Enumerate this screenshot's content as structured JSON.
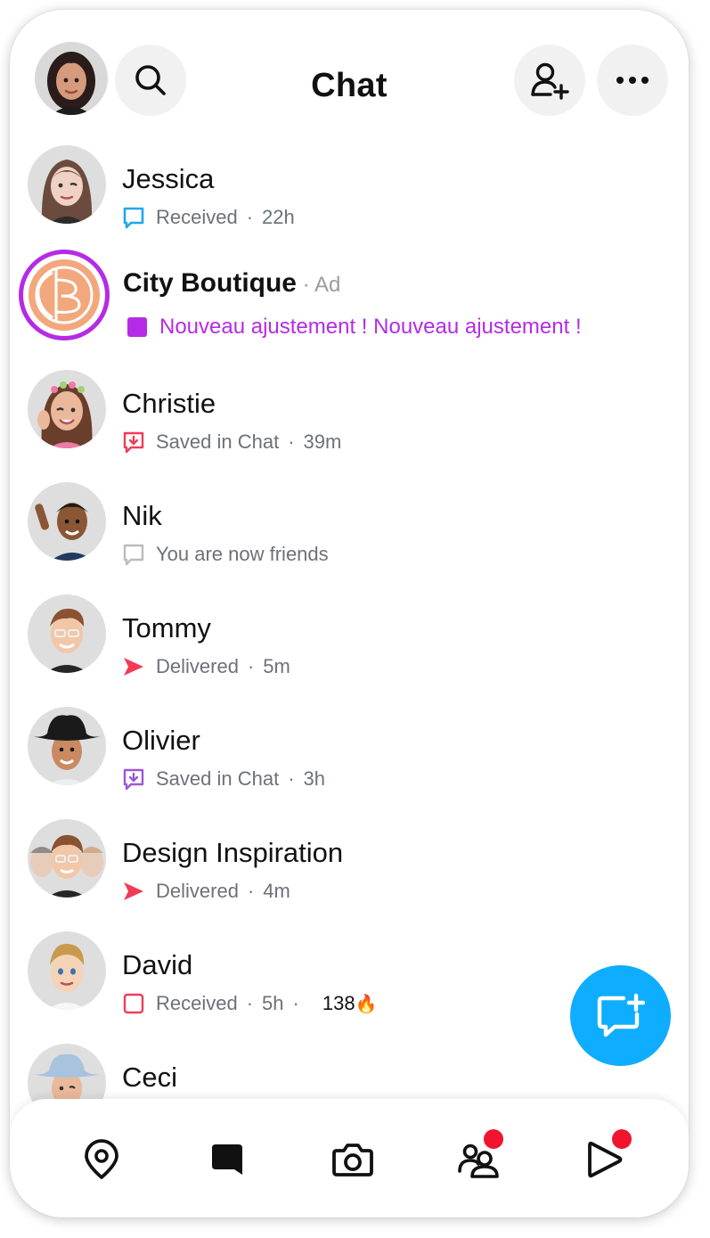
{
  "header": {
    "title": "Chat",
    "profile_icon": "bitmoji-avatar",
    "search_icon": "search-icon",
    "add_friend_icon": "add-friend-icon",
    "more_icon": "more-icon"
  },
  "chats": [
    {
      "name": "Jessica",
      "status": "Received",
      "time": "22h",
      "icon": "chat-received-outline",
      "color": "#1fa7f0"
    },
    {
      "name": "City Boutique",
      "ad_label": "Ad",
      "message": "Nouveau ajustement ! Nouveau ajustement !",
      "icon": "ad-square-filled",
      "color": "#b52be5"
    },
    {
      "name": "Christie",
      "status": "Saved in Chat",
      "time": "39m",
      "icon": "saved-in-chat",
      "color": "#f23c57"
    },
    {
      "name": "Nik",
      "status": "You are now friends",
      "icon": "chat-empty-outline",
      "color": "#b9bbbf"
    },
    {
      "name": "Tommy",
      "status": "Delivered",
      "time": "5m",
      "icon": "snap-delivered-arrow",
      "color": "#f23c57"
    },
    {
      "name": "Olivier",
      "status": "Saved in Chat",
      "time": "3h",
      "icon": "saved-in-chat",
      "color": "#9b58d6"
    },
    {
      "name": "Design Inspiration",
      "status": "Delivered",
      "time": "4m",
      "icon": "snap-delivered-arrow",
      "color": "#f23c57"
    },
    {
      "name": "David",
      "status": "Received",
      "time": "5h",
      "streak": "138",
      "streak_emoji": "🔥",
      "icon": "snap-received-square",
      "color": "#f23c57"
    },
    {
      "name": "Ceci"
    }
  ],
  "fab": {
    "icon": "new-chat-icon",
    "color": "#0fadff"
  },
  "bottom_nav": [
    {
      "icon": "map-icon"
    },
    {
      "icon": "chat-icon",
      "active": true
    },
    {
      "icon": "camera-icon"
    },
    {
      "icon": "friends-icon",
      "badge": true
    },
    {
      "icon": "stories-play-icon",
      "badge": true
    }
  ],
  "colors": {
    "accent_blue": "#0fadff",
    "notification_red": "#f0142f",
    "ad_purple": "#b52be5"
  }
}
